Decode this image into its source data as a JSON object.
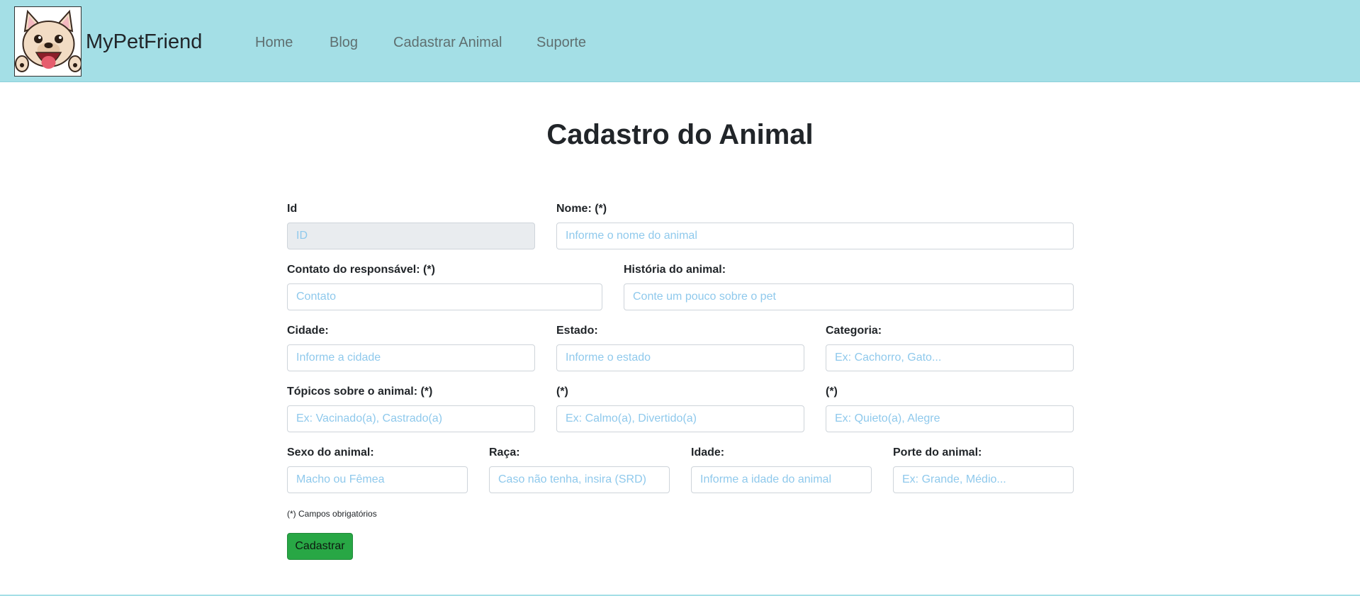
{
  "nav": {
    "brand": "MyPetFriend",
    "links": [
      "Home",
      "Blog",
      "Cadastrar Animal",
      "Suporte"
    ]
  },
  "page": {
    "title": "Cadastro do Animal"
  },
  "form": {
    "id": {
      "label": "Id",
      "placeholder": "ID"
    },
    "nome": {
      "label": "Nome: (*)",
      "placeholder": "Informe o nome do animal"
    },
    "contato": {
      "label": "Contato do responsável: (*)",
      "placeholder": "Contato"
    },
    "historia": {
      "label": "História do animal:",
      "placeholder": "Conte um pouco sobre o pet"
    },
    "cidade": {
      "label": "Cidade:",
      "placeholder": "Informe a cidade"
    },
    "estado": {
      "label": "Estado:",
      "placeholder": "Informe o estado"
    },
    "categoria": {
      "label": "Categoria:",
      "placeholder": "Ex: Cachorro, Gato..."
    },
    "topico1": {
      "label": "Tópicos sobre o animal: (*)",
      "placeholder": "Ex: Vacinado(a), Castrado(a)"
    },
    "topico2": {
      "label": "(*)",
      "placeholder": "Ex: Calmo(a), Divertido(a)"
    },
    "topico3": {
      "label": "(*)",
      "placeholder": "Ex: Quieto(a), Alegre"
    },
    "sexo": {
      "label": "Sexo do animal:",
      "placeholder": "Macho ou Fêmea"
    },
    "raca": {
      "label": "Raça:",
      "placeholder": "Caso não tenha, insira (SRD)"
    },
    "idade": {
      "label": "Idade:",
      "placeholder": "Informe a idade do animal"
    },
    "porte": {
      "label": "Porte do animal:",
      "placeholder": "Ex: Grande, Médio..."
    },
    "required_note": "(*) Campos obrigatórios",
    "submit_label": "Cadastrar"
  },
  "colors": {
    "navbar": "#a4dfe6",
    "placeholder": "#8fc9ec",
    "submit": "#28a745"
  }
}
